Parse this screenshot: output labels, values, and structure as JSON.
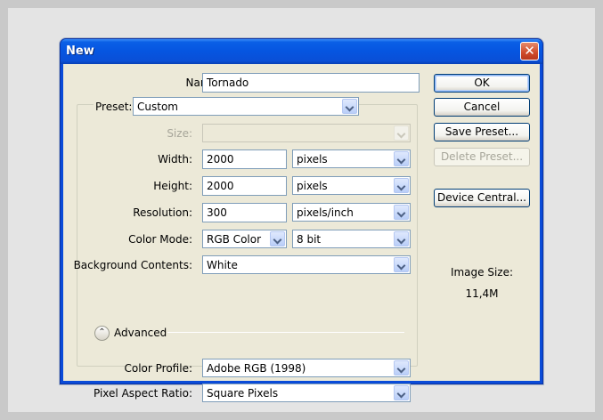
{
  "dialog": {
    "title": "New",
    "close_glyph": "✕"
  },
  "fields": {
    "name_label": "Name:",
    "name_value": "Tornado",
    "preset_label": "Preset:",
    "preset_value": "Custom",
    "size_label": "Size:",
    "size_value": "",
    "width_label": "Width:",
    "width_value": "2000",
    "width_unit": "pixels",
    "height_label": "Height:",
    "height_value": "2000",
    "height_unit": "pixels",
    "resolution_label": "Resolution:",
    "resolution_value": "300",
    "resolution_unit": "pixels/inch",
    "color_mode_label": "Color Mode:",
    "color_mode_value": "RGB Color",
    "bit_depth_value": "8 bit",
    "background_label": "Background Contents:",
    "background_value": "White",
    "advanced_label": "Advanced",
    "color_profile_label": "Color Profile:",
    "color_profile_value": "Adobe RGB (1998)",
    "pixel_aspect_label": "Pixel Aspect Ratio:",
    "pixel_aspect_value": "Square Pixels"
  },
  "buttons": {
    "ok": "OK",
    "cancel": "Cancel",
    "save_preset": "Save Preset...",
    "delete_preset": "Delete Preset...",
    "device_central": "Device Central..."
  },
  "image_size": {
    "label": "Image Size:",
    "value": "11,4M"
  },
  "icons": {
    "close": "close-icon",
    "advanced_toggle": "chevron-up-double-icon",
    "dropdown": "chevron-down-icon"
  },
  "colors": {
    "titlebar": "#0655e0",
    "client_bg": "#ece9d8",
    "close_button": "#cf4a2a"
  }
}
